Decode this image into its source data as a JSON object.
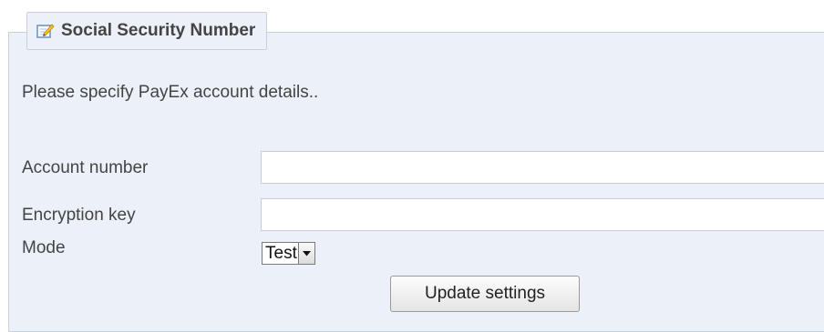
{
  "fieldset": {
    "legend_icon": "edit-note-icon",
    "legend_title": "Social Security Number"
  },
  "intro_text": "Please specify PayEx account details..",
  "form": {
    "account_number": {
      "label": "Account number",
      "value": ""
    },
    "encryption_key": {
      "label": "Encryption key",
      "value": ""
    },
    "mode": {
      "label": "Mode",
      "selected": "Test",
      "arrow_icon": "dropdown-arrow-icon"
    },
    "submit_label": "Update settings"
  },
  "colors": {
    "panel_background": "#ecf0f8",
    "panel_border": "#c8d0e0",
    "text": "#444444"
  }
}
